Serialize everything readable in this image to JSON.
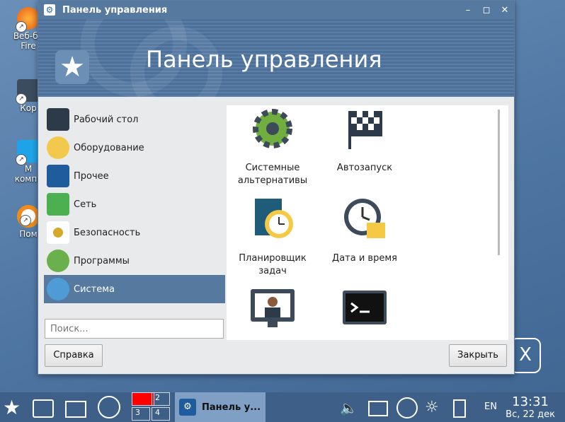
{
  "desktop": {
    "icons": [
      {
        "label1": "Веб-бр",
        "label2": "Fire"
      },
      {
        "label1": "Кор",
        "label2": ""
      },
      {
        "label1": "М",
        "label2": "компь"
      },
      {
        "label1": "Пом",
        "label2": ""
      }
    ]
  },
  "window": {
    "title": "Панель управления",
    "banner_title": "Панель управления",
    "controls": {
      "minimize": "–",
      "maximize": "◻",
      "close": "✕"
    }
  },
  "sidebar": {
    "items": [
      {
        "label": "Рабочий стол",
        "icon": "desktop-palette-icon"
      },
      {
        "label": "Оборудование",
        "icon": "hardware-mouse-icon"
      },
      {
        "label": "Прочее",
        "icon": "misc-gear-icon"
      },
      {
        "label": "Сеть",
        "icon": "network-monitors-icon"
      },
      {
        "label": "Безопасность",
        "icon": "security-lock-icon"
      },
      {
        "label": "Программы",
        "icon": "programs-monitor-icon"
      },
      {
        "label": "Система",
        "icon": "system-gear-icon",
        "active": true
      }
    ],
    "search_placeholder": "Поиск..."
  },
  "content": {
    "tiles": [
      {
        "line1": "Системные",
        "line2": "альтернативы",
        "icon": "gear-icon"
      },
      {
        "line1": "Автозапуск",
        "line2": "",
        "icon": "checkered-flag-icon"
      },
      {
        "line1": "Планировщик",
        "line2": "задач",
        "icon": "task-scheduler-icon"
      },
      {
        "line1": "Дата и время",
        "line2": "",
        "icon": "clock-calendar-icon"
      },
      {
        "line1": "",
        "line2": "",
        "icon": "user-monitor-icon"
      },
      {
        "line1": "",
        "line2": "",
        "icon": "terminal-icon"
      }
    ]
  },
  "buttons": {
    "help": "Справка",
    "close": "Закрыть"
  },
  "taskbar": {
    "pager": [
      "",
      "2",
      "3",
      "4"
    ],
    "task_title": "Панель у...",
    "lang": "EN",
    "time": "13:31",
    "date": "Вс, 22 дек"
  },
  "colors": {
    "accent": "#55799f",
    "taskbar": "#3d5f88",
    "active_task": "#7f9fc4"
  }
}
